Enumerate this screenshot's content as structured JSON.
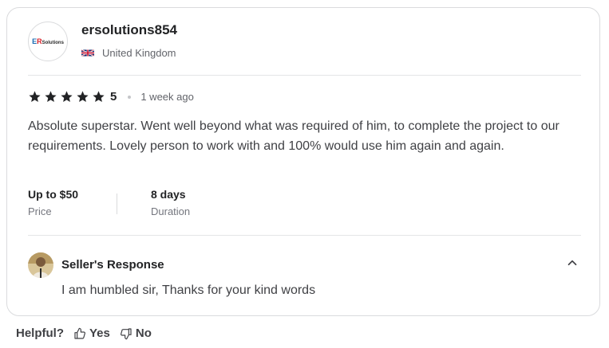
{
  "reviewer": {
    "logo_text": "ER Solutions",
    "username": "ersolutions854",
    "country": "United Kingdom",
    "flag_icon": "uk-flag-icon"
  },
  "rating": {
    "stars": 5,
    "value": "5",
    "time_ago": "1 week ago",
    "star_color": "#222325"
  },
  "review": {
    "text": "Absolute superstar. Went well beyond what was required of him, to complete the project to our requirements. Lovely person to work with and 100% would use him again and again."
  },
  "meta": {
    "price_value": "Up to $50",
    "price_label": "Price",
    "duration_value": "8 days",
    "duration_label": "Duration"
  },
  "seller_response": {
    "title": "Seller's Response",
    "text": "I am humbled sir, Thanks for your kind words",
    "toggle_icon": "chevron-up-icon"
  },
  "helpful": {
    "label": "Helpful?",
    "yes_label": "Yes",
    "no_label": "No",
    "yes_icon": "thumbs-up-icon",
    "no_icon": "thumbs-down-icon"
  }
}
